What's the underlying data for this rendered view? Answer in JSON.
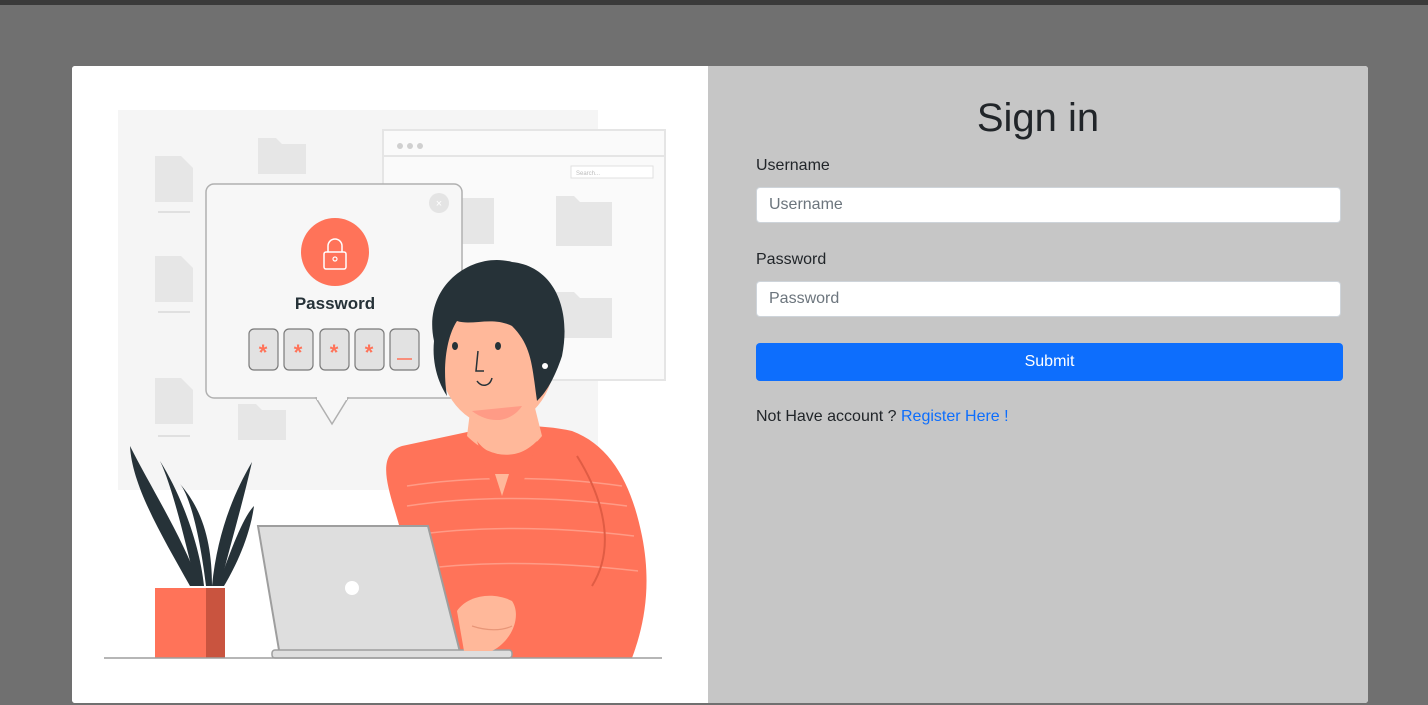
{
  "illustration": {
    "popup_title": "Password",
    "search_placeholder": "Search...",
    "pin_masks": [
      "*",
      "*",
      "*",
      "*"
    ]
  },
  "form": {
    "title": "Sign in",
    "username_label": "Username",
    "username_placeholder": "Username",
    "username_value": "",
    "password_label": "Password",
    "password_placeholder": "Password",
    "password_value": "",
    "submit_label": "Submit",
    "register_prompt": "Not Have account ?",
    "register_link": "Register Here !"
  },
  "colors": {
    "accent": "#0d6efd",
    "panel": "#c6c6c6",
    "backdrop": "#707070",
    "illustration_accent": "#ff7359"
  }
}
